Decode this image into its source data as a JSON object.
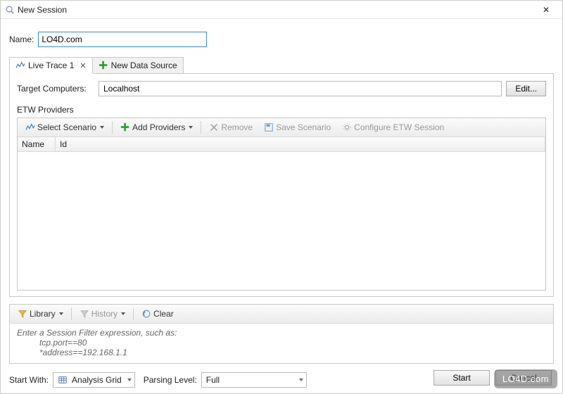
{
  "window": {
    "title": "New Session",
    "close_glyph": "✕"
  },
  "name_field": {
    "label": "Name:",
    "value": "LO4D.com"
  },
  "tabs": {
    "active_label": "Live Trace 1",
    "new_ds_label": "New Data Source"
  },
  "target": {
    "label": "Target Computers:",
    "value": "Localhost",
    "edit_label": "Edit..."
  },
  "etw": {
    "section_label": "ETW Providers",
    "toolbar": {
      "select_scenario": "Select Scenario",
      "add_providers": "Add Providers",
      "remove": "Remove",
      "save_scenario": "Save Scenario",
      "configure": "Configure ETW Session"
    },
    "grid_columns": {
      "name": "Name",
      "id": "Id"
    }
  },
  "filter_toolbar": {
    "library": "Library",
    "history": "History",
    "clear": "Clear"
  },
  "filter_hint": {
    "line1": "Enter a Session Filter expression, such as:",
    "line2": "tcp.port==80",
    "line3": "*address==192.168.1.1"
  },
  "start_with": {
    "label": "Start With:",
    "value": "Analysis Grid"
  },
  "parsing_level": {
    "label": "Parsing Level:",
    "value": "Full"
  },
  "dialog_buttons": {
    "start": "Start",
    "cancel": "Cancel"
  },
  "watermark": "LO4D.com"
}
